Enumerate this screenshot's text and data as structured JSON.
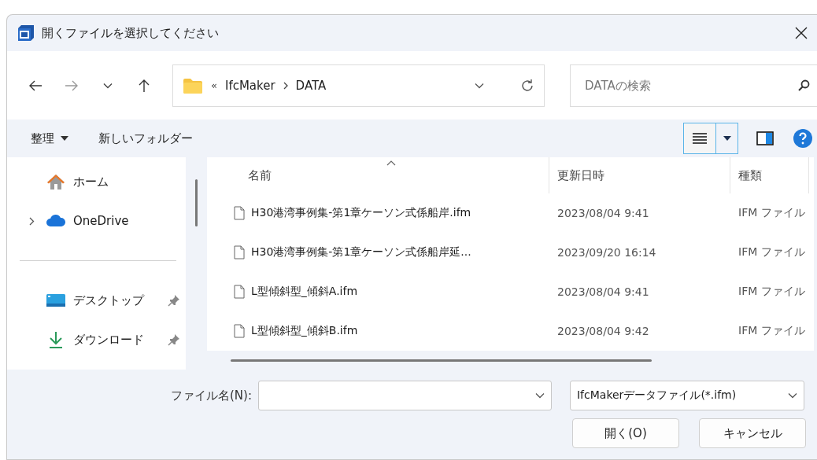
{
  "window": {
    "title": "開くファイルを選択してください"
  },
  "address_bar": {
    "overflow": "«",
    "segments": [
      "IfcMaker",
      "DATA"
    ]
  },
  "search": {
    "placeholder": "DATAの検索"
  },
  "toolbar": {
    "organize": "整理",
    "new_folder": "新しいフォルダー"
  },
  "sidebar": {
    "groups": [
      [
        {
          "label": "ホーム",
          "kind": "home",
          "expandable": false,
          "pinned": false
        },
        {
          "label": "OneDrive",
          "kind": "cloud",
          "expandable": true,
          "pinned": false
        }
      ],
      [
        {
          "label": "デスクトップ",
          "kind": "desktop",
          "expandable": false,
          "pinned": true
        },
        {
          "label": "ダウンロード",
          "kind": "download",
          "expandable": false,
          "pinned": true
        }
      ]
    ]
  },
  "table": {
    "columns": [
      "名前",
      "更新日時",
      "種類"
    ],
    "rows": [
      {
        "name": "H30港湾事例集-第1章ケーソン式係船岸.ifm",
        "modified": "2023/08/04 9:41",
        "type": "IFM ファイル"
      },
      {
        "name": "H30港湾事例集-第1章ケーソン式係船岸延...",
        "modified": "2023/09/20 16:14",
        "type": "IFM ファイル"
      },
      {
        "name": "L型傾斜型_傾斜A.ifm",
        "modified": "2023/08/04 9:41",
        "type": "IFM ファイル"
      },
      {
        "name": "L型傾斜型_傾斜B.ifm",
        "modified": "2023/08/04 9:42",
        "type": "IFM ファイル"
      }
    ]
  },
  "footer": {
    "filename_label": "ファイル名(N):",
    "filter": "IfcMakerデータファイル(*.ifm)",
    "buttons": [
      "開く(O)",
      "キャンセル"
    ]
  }
}
